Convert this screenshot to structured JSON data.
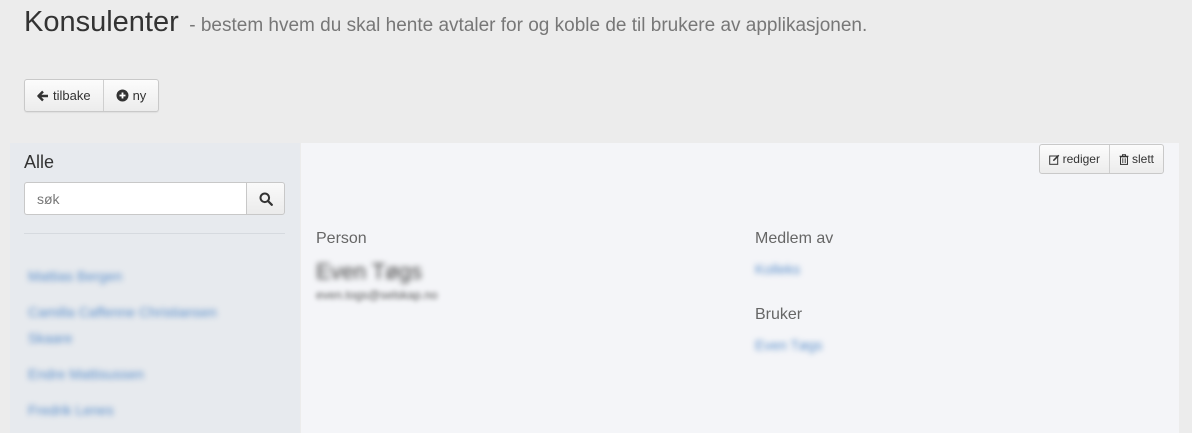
{
  "header": {
    "title": "Konsulenter",
    "subtitle": "- bestem hvem du skal hente avtaler for og koble de til brukere av applikasjonen."
  },
  "toolbar": {
    "back_label": "tilbake",
    "new_label": "ny"
  },
  "sidebar": {
    "heading": "Alle",
    "search_placeholder": "søk",
    "items": [
      {
        "label": "Mattias Bergen"
      },
      {
        "label": "Camilla Caffenne Christiansen Skaare"
      },
      {
        "label": "Endre Mattisussen"
      },
      {
        "label": "Fredrik Lenes"
      }
    ]
  },
  "detail": {
    "edit_label": "rediger",
    "delete_label": "slett",
    "person_label": "Person",
    "person_name": "Even Tøgs",
    "person_email": "even.togs@selskap.no",
    "member_label": "Medlem av",
    "member_value": "Kolleks",
    "user_label": "Bruker",
    "user_value": "Even Tøgs"
  },
  "colors": {
    "link": "#5b8fcb",
    "sidebar_bg": "#e7eaee",
    "detail_bg": "#f4f5f8",
    "page_bg": "#ececec"
  },
  "icons": {
    "back": "arrow-left-icon",
    "new": "plus-circle-icon",
    "search": "search-icon",
    "edit": "edit-icon",
    "delete": "trash-icon"
  }
}
